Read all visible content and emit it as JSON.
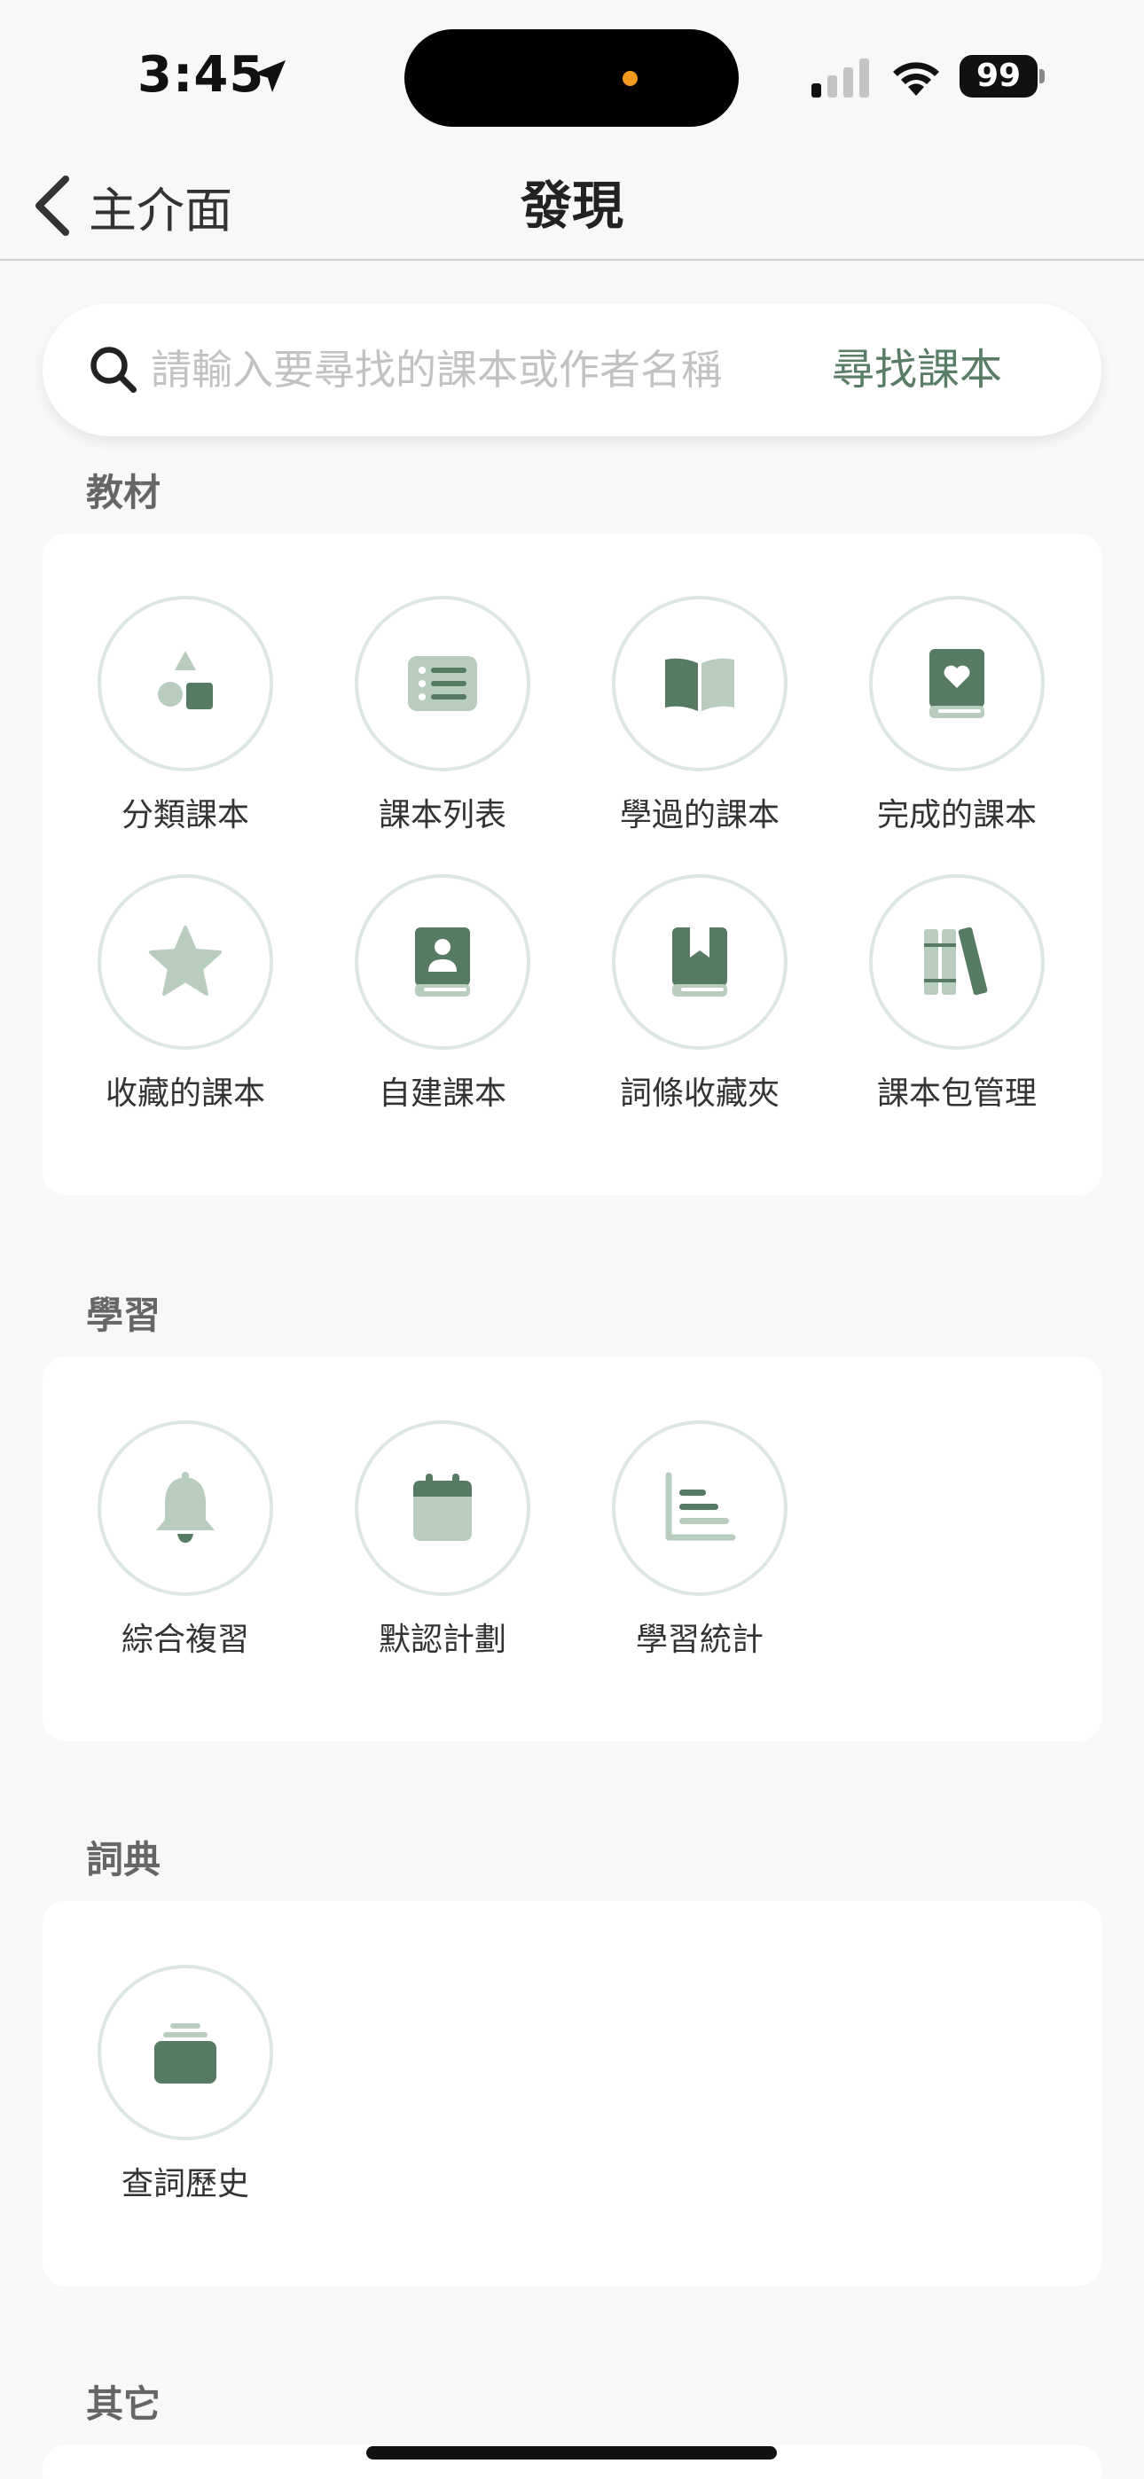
{
  "status_bar": {
    "time": "3:45",
    "battery": "99"
  },
  "nav": {
    "back_label": "主介面",
    "title": "發現"
  },
  "search": {
    "placeholder": "請輸入要尋找的課本或作者名稱",
    "button_label": "尋找課本"
  },
  "colors": {
    "accent": "#5a7d65",
    "icon_light": "#b9cdbf",
    "icon_dark": "#567a62",
    "circle_border": "#dce7e1"
  },
  "sections": {
    "materials": {
      "title": "教材",
      "items": [
        {
          "label": "分類課本",
          "icon": "shapes-icon"
        },
        {
          "label": "課本列表",
          "icon": "list-icon"
        },
        {
          "label": "學過的課本",
          "icon": "open-book-icon"
        },
        {
          "label": "完成的課本",
          "icon": "heart-book-icon"
        },
        {
          "label": "收藏的課本",
          "icon": "star-icon"
        },
        {
          "label": "自建課本",
          "icon": "contact-book-icon"
        },
        {
          "label": "詞條收藏夾",
          "icon": "bookmark-book-icon"
        },
        {
          "label": "課本包管理",
          "icon": "books-shelf-icon"
        }
      ]
    },
    "learning": {
      "title": "學習",
      "items": [
        {
          "label": "綜合複習",
          "icon": "bell-icon"
        },
        {
          "label": "默認計劃",
          "icon": "calendar-icon"
        },
        {
          "label": "學習統計",
          "icon": "bar-chart-icon"
        }
      ]
    },
    "dictionary": {
      "title": "詞典",
      "items": [
        {
          "label": "查詞歷史",
          "icon": "stack-icon"
        }
      ]
    },
    "other": {
      "title": "其它"
    }
  }
}
